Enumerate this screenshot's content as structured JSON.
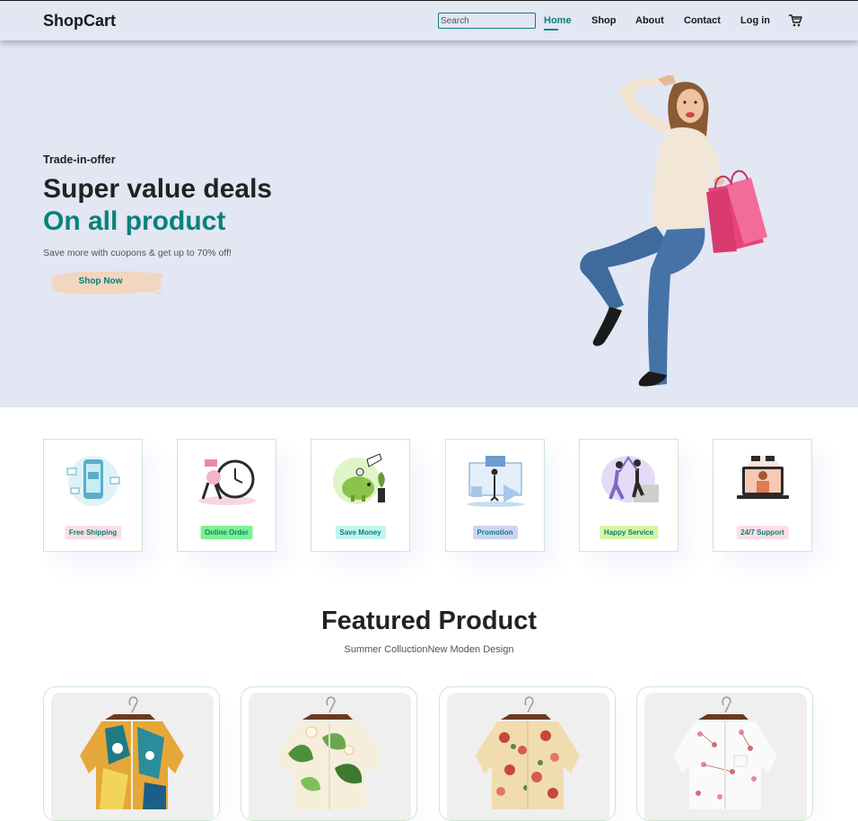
{
  "header": {
    "logo": "ShopCart",
    "search_placeholder": "Search",
    "nav": [
      "Home",
      "Shop",
      "About",
      "Contact",
      "Log in"
    ],
    "active_nav": "Home",
    "cart_icon": "cart-icon"
  },
  "hero": {
    "eyebrow": "Trade-in-offer",
    "title": "Super value deals",
    "subtitle": "On all product",
    "description": "Save more with cuopons & get up to 70% off!",
    "button_label": "Shop Now"
  },
  "features": [
    {
      "label": "Free Shipping",
      "color": "#fddde4"
    },
    {
      "label": "Online Order",
      "color": "#7bf28f"
    },
    {
      "label": "Save Money",
      "color": "#c4f5f0"
    },
    {
      "label": "Promotion",
      "color": "#cdd4f8"
    },
    {
      "label": "Happy Service",
      "color": "#d6f5a3"
    },
    {
      "label": "24/7 Support",
      "color": "#fddde4"
    }
  ],
  "featured": {
    "title": "Featured Product",
    "subtitle": "Summer ColluctionNew Moden Design"
  },
  "colors": {
    "accent": "#088178",
    "header_bg": "#e3e6f3",
    "button_bg": "#f1d6c0"
  }
}
